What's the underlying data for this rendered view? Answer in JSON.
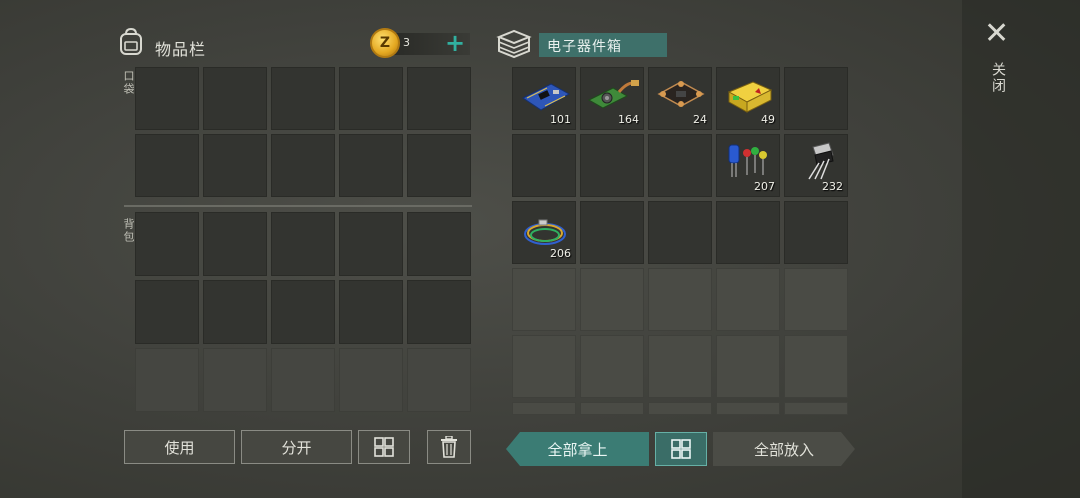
{
  "inventory": {
    "title": "物品栏",
    "pocket_label": "口袋",
    "backpack_label": "背包",
    "coins": "3",
    "coin_symbol": "Z",
    "add_symbol": "+"
  },
  "container": {
    "title": "电子器件箱",
    "items": [
      {
        "name": "circuit-board",
        "qty": "101"
      },
      {
        "name": "sensor-board",
        "qty": "164"
      },
      {
        "name": "flight-controller",
        "qty": "24"
      },
      {
        "name": "battery-pack",
        "qty": "49"
      },
      {
        "name": "capacitors",
        "qty": "207"
      },
      {
        "name": "transistor",
        "qty": "232"
      },
      {
        "name": "wires",
        "qty": "206"
      }
    ]
  },
  "close": {
    "symbol": "✕",
    "label": "关闭"
  },
  "buttons": {
    "use": "使用",
    "split": "分开",
    "take_all": "全部拿上",
    "put_all": "全部放入",
    "sort_glyph": "⊞",
    "trash_glyph": "🗑"
  },
  "colors": {
    "accent_teal": "#3b7c74",
    "coin_gold": "#e4a821"
  }
}
